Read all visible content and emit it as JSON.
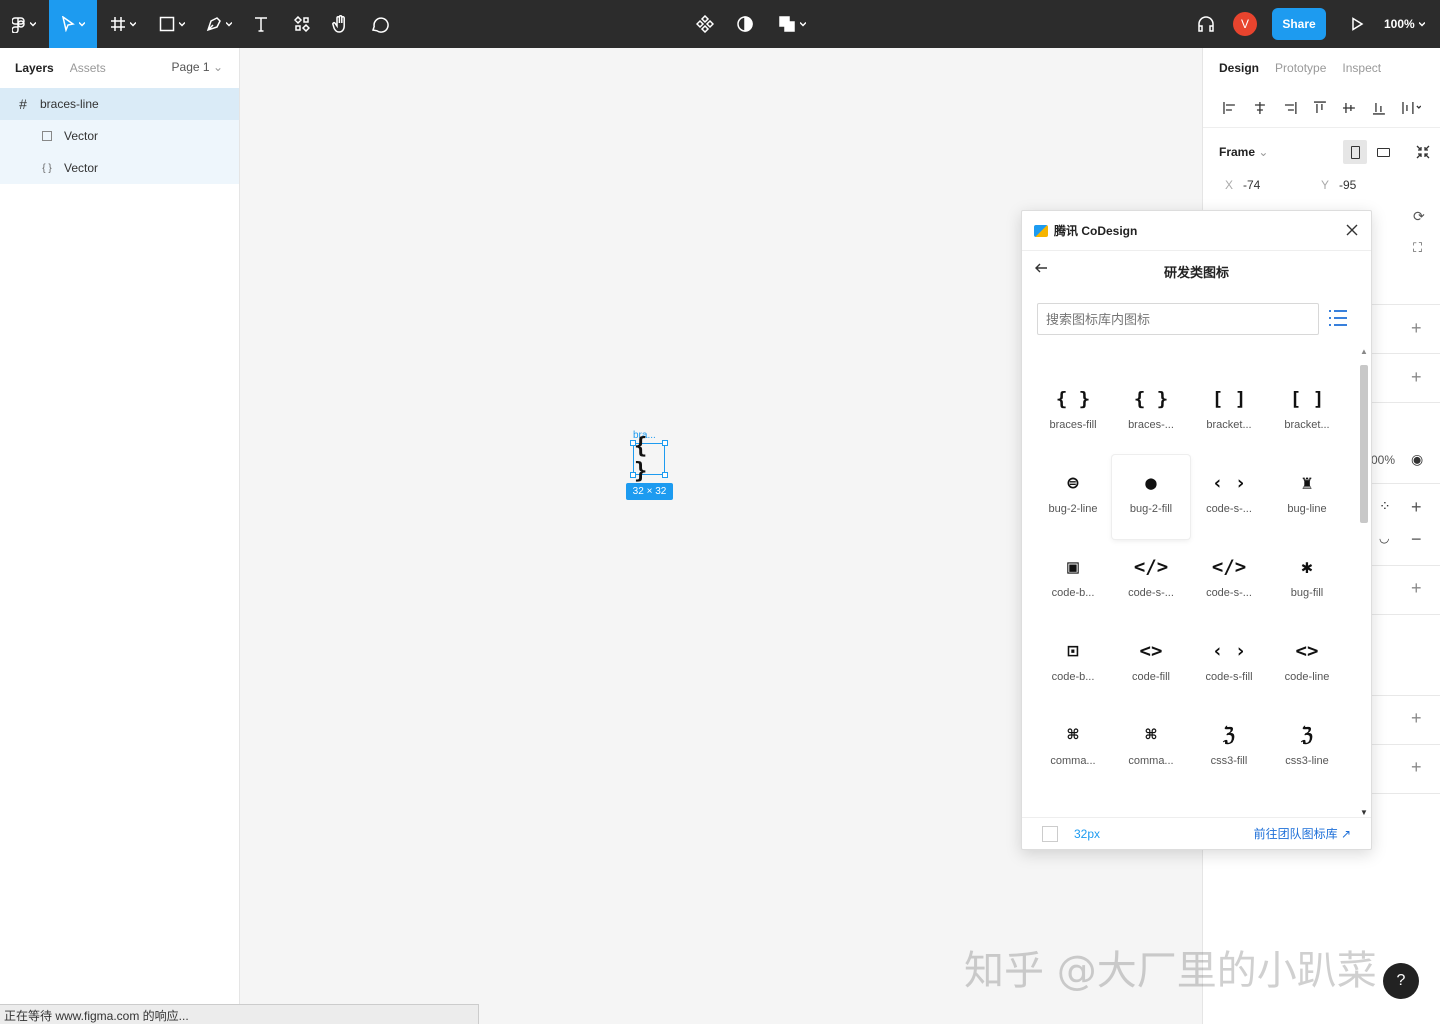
{
  "toolbar": {
    "share_label": "Share",
    "zoom": "100%",
    "avatar_initial": "V"
  },
  "left_panel": {
    "tabs": [
      "Layers",
      "Assets"
    ],
    "page": "Page 1",
    "layers": [
      {
        "name": "braces-line"
      },
      {
        "name": "Vector"
      },
      {
        "name": "Vector"
      }
    ]
  },
  "canvas": {
    "frame_label": "bra...",
    "frame_glyph": "{ }",
    "size_badge": "32 × 32"
  },
  "right_panel": {
    "tabs": [
      "Design",
      "Prototype",
      "Inspect"
    ],
    "frame_label": "Frame",
    "x_label": "X",
    "x_value": "-74",
    "y_label": "Y",
    "y_value": "-95",
    "opacity": "00%"
  },
  "plugin": {
    "title": "腾讯 CoDesign",
    "subtitle": "研发类图标",
    "search_placeholder": "搜索图标库内图标",
    "icons": [
      {
        "glyph": "{ }",
        "label": "braces-fill"
      },
      {
        "glyph": "{ }",
        "label": "braces-..."
      },
      {
        "glyph": "[ ]",
        "label": "bracket..."
      },
      {
        "glyph": "[ ]",
        "label": "bracket..."
      },
      {
        "glyph": "⊜",
        "label": "bug-2-line"
      },
      {
        "glyph": "●",
        "label": "bug-2-fill"
      },
      {
        "glyph": "‹ ›",
        "label": "code-s-..."
      },
      {
        "glyph": "♜",
        "label": "bug-line"
      },
      {
        "glyph": "▣",
        "label": "code-b..."
      },
      {
        "glyph": "</>",
        "label": "code-s-..."
      },
      {
        "glyph": "</>",
        "label": "code-s-..."
      },
      {
        "glyph": "✱",
        "label": "bug-fill"
      },
      {
        "glyph": "⊡",
        "label": "code-b..."
      },
      {
        "glyph": "<>",
        "label": "code-fill"
      },
      {
        "glyph": "‹ ›",
        "label": "code-s-fill"
      },
      {
        "glyph": "<>",
        "label": "code-line"
      },
      {
        "glyph": "⌘",
        "label": "comma..."
      },
      {
        "glyph": "⌘",
        "label": "comma..."
      },
      {
        "glyph": "ℨ",
        "label": "css3-fill"
      },
      {
        "glyph": "ℨ",
        "label": "css3-line"
      }
    ],
    "footer_size": "32px",
    "footer_link": "前往团队图标库"
  },
  "watermark": "知乎 @大厂里的小趴菜",
  "help": "?",
  "status_bar": "正在等待 www.figma.com 的响应..."
}
